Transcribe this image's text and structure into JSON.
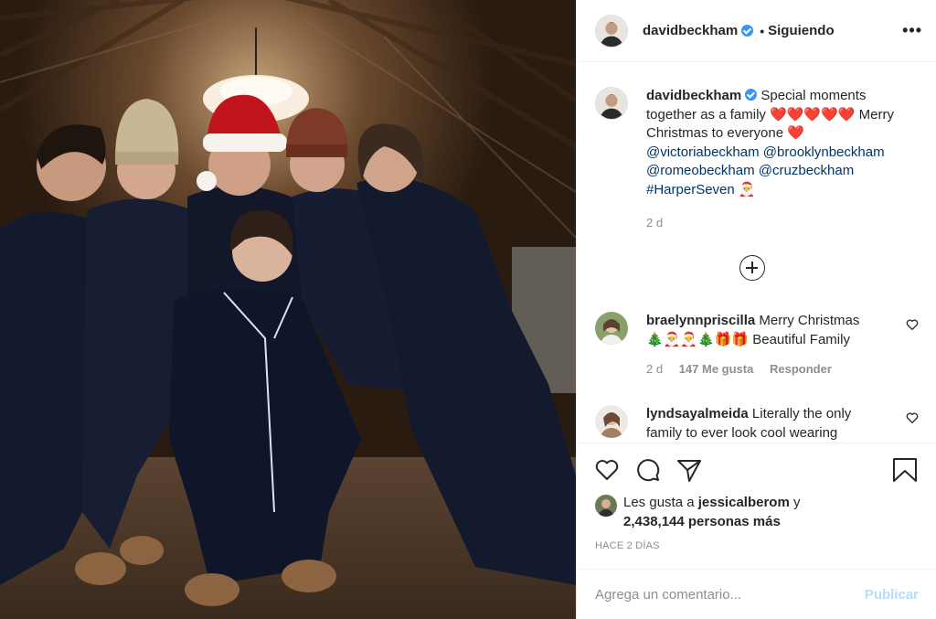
{
  "post": {
    "author": {
      "username": "davidbeckham",
      "verified": true
    },
    "follow_status": "Siguiendo",
    "more_icon": "more-horizontal-icon",
    "photo_icon": "family-photo"
  },
  "caption": {
    "username": "davidbeckham",
    "text_1": "Special moments together as a family",
    "hearts": "❤️❤️❤️❤️❤️",
    "text_2": "Merry Christmas to everyone",
    "heart": "❤️",
    "mention_1": "@victoriabeckham",
    "mention_2": "@brooklynbeckham",
    "mention_3": "@romeobeckham",
    "mention_4": "@cruzbeckham",
    "hashtag": "#HarperSeven",
    "santa": "🎅",
    "time": "2 d"
  },
  "comments": [
    {
      "username": "braelynnpriscilla",
      "text": "Merry Christmas",
      "emoji": "🎄🎅🎅🎄🎁🎁",
      "text_2": "Beautiful Family",
      "time": "2 d",
      "likes": "147 Me gusta",
      "reply": "Responder"
    },
    {
      "username": "lyndsayalmeida",
      "text": "Literally the only family to ever look cool wearing"
    }
  ],
  "actions": {
    "like_icon": "heart-icon",
    "comment_icon": "comment-icon",
    "share_icon": "share-icon",
    "save_icon": "bookmark-icon"
  },
  "likes": {
    "prefix": "Les gusta a",
    "user": "jessicalberom",
    "conj": "y",
    "count_text": "2,438,144 personas más"
  },
  "posted": "HACE 2 DÍAS",
  "add_comment": {
    "placeholder": "Agrega un comentario...",
    "publish": "Publicar"
  },
  "colors": {
    "link": "#003569",
    "verified": "#3897f0",
    "publish_disabled": "#b2dffc",
    "muted": "#8e8e8e"
  }
}
